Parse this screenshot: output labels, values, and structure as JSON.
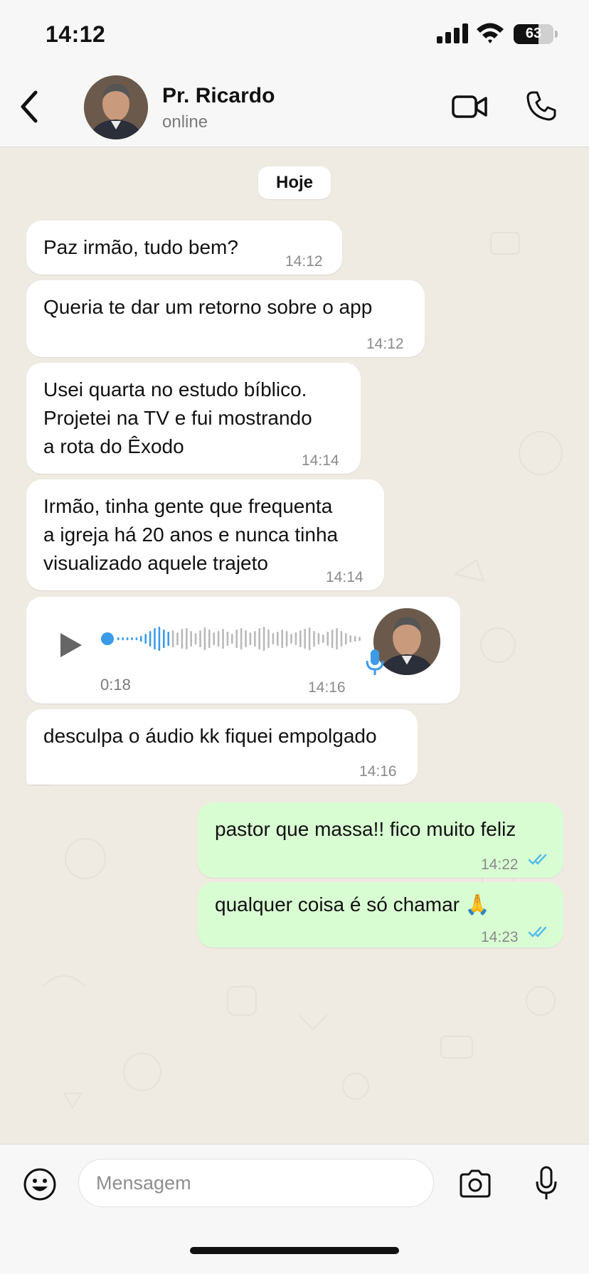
{
  "status_bar": {
    "time": "14:12",
    "battery": "63",
    "battery_level": 0.63
  },
  "header": {
    "name": "Pr. Ricardo",
    "status": "online"
  },
  "chat": {
    "day_label": "Hoje",
    "messages": [
      {
        "text": "Paz irmão, tudo bem?",
        "time": "14:12",
        "direction": "in"
      },
      {
        "text": "Queria te dar um retorno sobre o app",
        "time": "14:12",
        "direction": "in"
      },
      {
        "text": "Usei quarta no estudo bíblico.\nProjetei na TV e fui mostrando\na rota do Êxodo",
        "time": "14:14",
        "direction": "in"
      },
      {
        "text": "Irmão, tinha gente que frequenta\na igreja há 20 anos e nunca tinha\nvisualizado aquele trajeto",
        "time": "14:14",
        "direction": "in"
      },
      {
        "type": "audio",
        "duration": "0:18",
        "time": "14:16",
        "direction": "in"
      },
      {
        "text": "desculpa o áudio kk fiquei empolgado",
        "time": "14:16",
        "direction": "in"
      },
      {
        "text": "pastor que massa!! fico muito feliz",
        "time": "14:22",
        "direction": "out",
        "status": "read"
      },
      {
        "text": "qualquer coisa é só chamar 🙏",
        "time": "14:23",
        "direction": "out",
        "status": "read"
      }
    ]
  },
  "composer": {
    "placeholder": "Mensagem"
  },
  "colors": {
    "outgoing_bubble": "#d9fdd3",
    "read_ticks": "#53bdeb",
    "audio_accent": "#3b9be8",
    "background": "#efeae2"
  }
}
